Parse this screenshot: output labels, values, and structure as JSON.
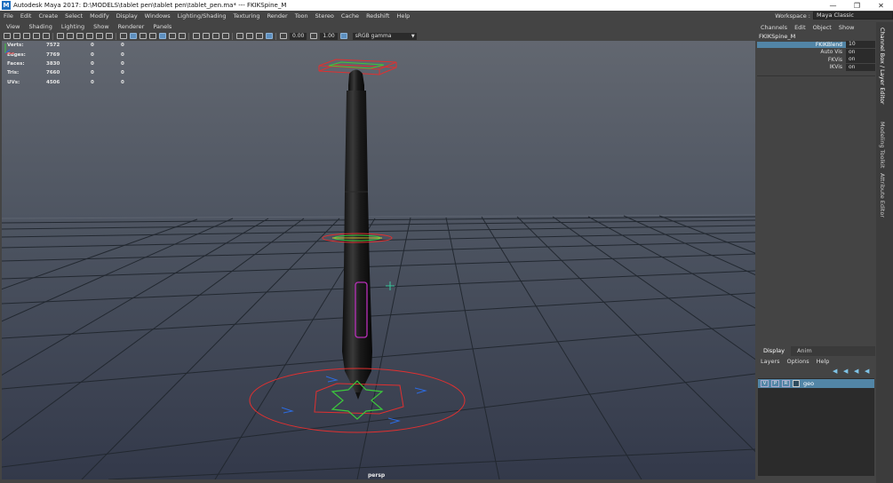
{
  "window": {
    "title": "Autodesk Maya 2017: D:\\MODELS\\tablet pen\\tablet pen\\tablet_pen.ma*   ---   FKIKSpine_M",
    "app_icon": "M"
  },
  "menubar": {
    "items": [
      "File",
      "Edit",
      "Create",
      "Select",
      "Modify",
      "Display",
      "Windows",
      "Lighting/Shading",
      "Texturing",
      "Render",
      "Toon",
      "Stereo",
      "Cache",
      "Redshift",
      "Help"
    ]
  },
  "workspace": {
    "label": "Workspace :",
    "value": "Maya Classic"
  },
  "viewport": {
    "menus": [
      "View",
      "Shading",
      "Lighting",
      "Show",
      "Renderer",
      "Panels"
    ],
    "toolbar": {
      "field1": "0.00",
      "field2": "1.00",
      "color_space": "sRGB gamma"
    },
    "hud": [
      {
        "label": "Verts:",
        "v1": "7572",
        "v2": "0",
        "v3": "0"
      },
      {
        "label": "Edges:",
        "v1": "7769",
        "v2": "0",
        "v3": "0"
      },
      {
        "label": "Faces:",
        "v1": "3830",
        "v2": "0",
        "v3": "0"
      },
      {
        "label": "Tris:",
        "v1": "7660",
        "v2": "0",
        "v3": "0"
      },
      {
        "label": "UVs:",
        "v1": "4506",
        "v2": "0",
        "v3": "0"
      }
    ],
    "camera": "persp"
  },
  "channel_box": {
    "menus": [
      "Channels",
      "Edit",
      "Object",
      "Show"
    ],
    "node": "FKIKSpine_M",
    "attributes": [
      {
        "name": "FKIKBlend",
        "value": "10",
        "selected": true
      },
      {
        "name": "Auto Vis",
        "value": "on",
        "selected": false
      },
      {
        "name": "FKVis",
        "value": "on",
        "selected": false
      },
      {
        "name": "IKVis",
        "value": "on",
        "selected": false
      }
    ]
  },
  "layer_editor": {
    "tabs": [
      "Display",
      "Anim"
    ],
    "menus": [
      "Layers",
      "Options",
      "Help"
    ],
    "layers": [
      {
        "v": "V",
        "p": "P",
        "r": "R",
        "name": "geo"
      }
    ]
  },
  "side_tabs": [
    "Channel Box / Layer Editor",
    "Modeling Toolkit",
    "Attribute Editor"
  ],
  "colors": {
    "selection": "#5285a6",
    "rig_red": "#e03030",
    "rig_green": "#3cc83c",
    "rig_blue": "#2c6be0"
  }
}
